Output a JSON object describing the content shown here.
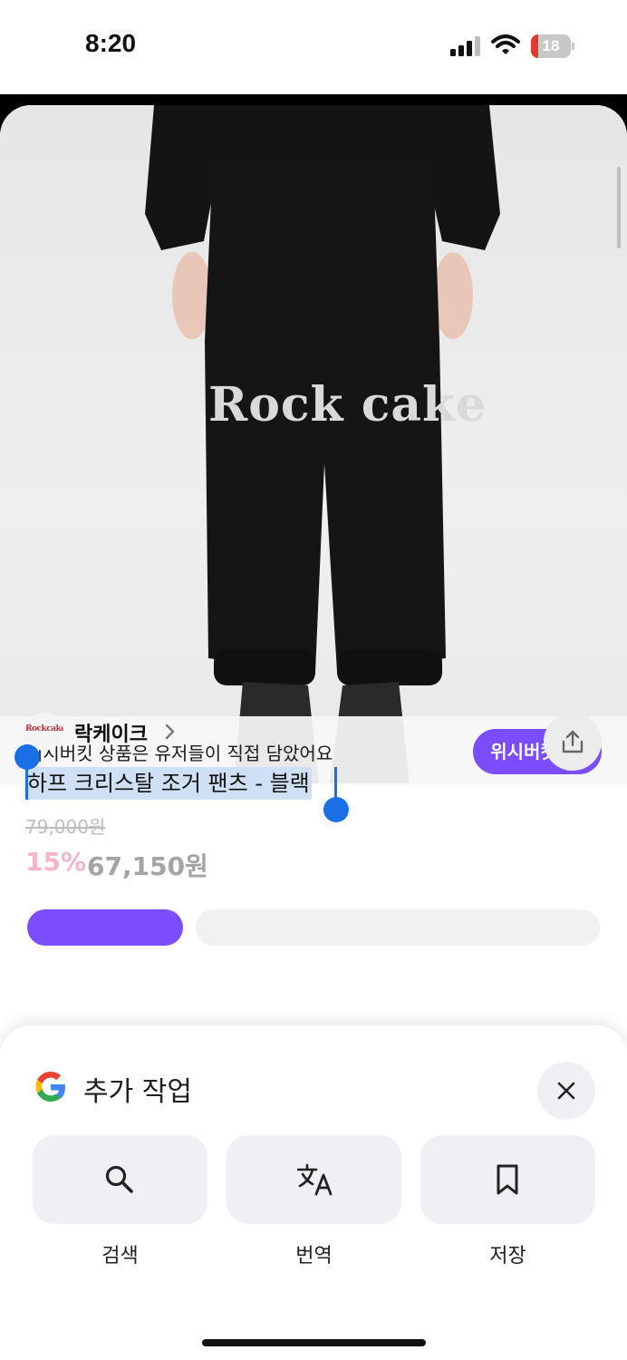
{
  "status_bar": {
    "time": "8:20",
    "battery_percent": 18,
    "battery_label": "18"
  },
  "product": {
    "image_text": "Rock cake",
    "wish_banner": {
      "text": "위시버킷 상품은 유저들이 직접 담았어요",
      "button_label": "위시버킷은?"
    },
    "brand": {
      "logo_text": "Rockcake",
      "name": "락케이크"
    },
    "title": "하프 크리스탈 조거 팬츠 - 블랙",
    "original_price": "79,000원",
    "discount": "15%",
    "sale_price": "67,150원"
  },
  "action_sheet": {
    "title": "추가 작업",
    "actions": [
      {
        "label": "검색",
        "icon": "search-icon"
      },
      {
        "label": "번역",
        "icon": "translate-icon"
      },
      {
        "label": "저장",
        "icon": "bookmark-icon"
      }
    ]
  },
  "colors": {
    "accent": "#7b4dff",
    "discount": "#f6b4c9",
    "selection": "#cfe0f5",
    "selection_handle": "#1a6ee6"
  }
}
